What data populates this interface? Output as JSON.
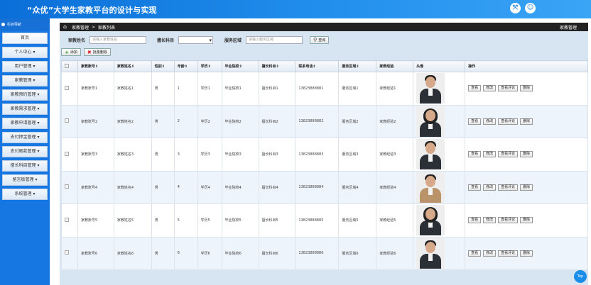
{
  "app": {
    "title": "“众优”大学生家教平台的设计与实现"
  },
  "header_icons": [
    "fullscreen-icon",
    "user-icon"
  ],
  "sidebar": {
    "title": "栏目导航",
    "items": [
      "首页",
      "个人中心 ▾",
      "用户管理 ▾",
      "家教管理 ▾",
      "家教预约管理 ▾",
      "家教需求管理 ▾",
      "家教申请管理 ▾",
      "支付押金管理 ▾",
      "支付尾款管理 ▾",
      "擅长科目管理 ▾",
      "留言板管理 ▾",
      "系统管理 ▾"
    ]
  },
  "breadcrumb": {
    "section": "家教管理",
    "sep": ">",
    "page": "家教列表",
    "right": "家教管理"
  },
  "search": {
    "account_label": "家教姓名",
    "account_placeholder": "请输入家教姓名",
    "subject_label": "擅长科目",
    "subject_value": "",
    "area_label": "服务区域",
    "area_placeholder": "请输入服务区域",
    "search_button": "查询"
  },
  "actions": {
    "add": "添加",
    "batch_delete": "批量删除"
  },
  "table": {
    "headers": [
      "家教账号⇕",
      "家教姓名⇕",
      "性别⇕",
      "年龄⇕",
      "学历⇕",
      "毕业院校⇕",
      "擅长科目⇕",
      "联系电话⇕",
      "服务区域⇕",
      "家教经验",
      "头像",
      "操作"
    ],
    "rows": [
      [
        "家教账号1",
        "家教姓名1",
        "男",
        "1",
        "学历1",
        "毕业院校1",
        "擅长科目1",
        "13823888881",
        "服务区域1",
        "家教经验1"
      ],
      [
        "家教账号2",
        "家教姓名2",
        "男",
        "2",
        "学历2",
        "毕业院校2",
        "擅长科目2",
        "13823888882",
        "服务区域2",
        "家教经验2"
      ],
      [
        "家教账号3",
        "家教姓名3",
        "男",
        "3",
        "学历3",
        "毕业院校3",
        "擅长科目3",
        "13823888883",
        "服务区域3",
        "家教经验3"
      ],
      [
        "家教账号4",
        "家教姓名4",
        "男",
        "4",
        "学历4",
        "毕业院校4",
        "擅长科目4",
        "13823888884",
        "服务区域4",
        "家教经验4"
      ],
      [
        "家教账号5",
        "家教姓名5",
        "男",
        "5",
        "学历5",
        "毕业院校5",
        "擅长科目5",
        "13823888885",
        "服务区域5",
        "家教经验5"
      ],
      [
        "家教账号6",
        "家教姓名6",
        "男",
        "6",
        "学历6",
        "毕业院校6",
        "擅长科目6",
        "13823888886",
        "服务区域6",
        "家教经验6"
      ]
    ],
    "row_actions": [
      "查看",
      "修改",
      "查看评论",
      "删除"
    ]
  },
  "scroll_top": "Top",
  "colors": {
    "header": "#1a7de0",
    "sidebar": "#1677e3",
    "content_bg": "#d7e4f2"
  }
}
